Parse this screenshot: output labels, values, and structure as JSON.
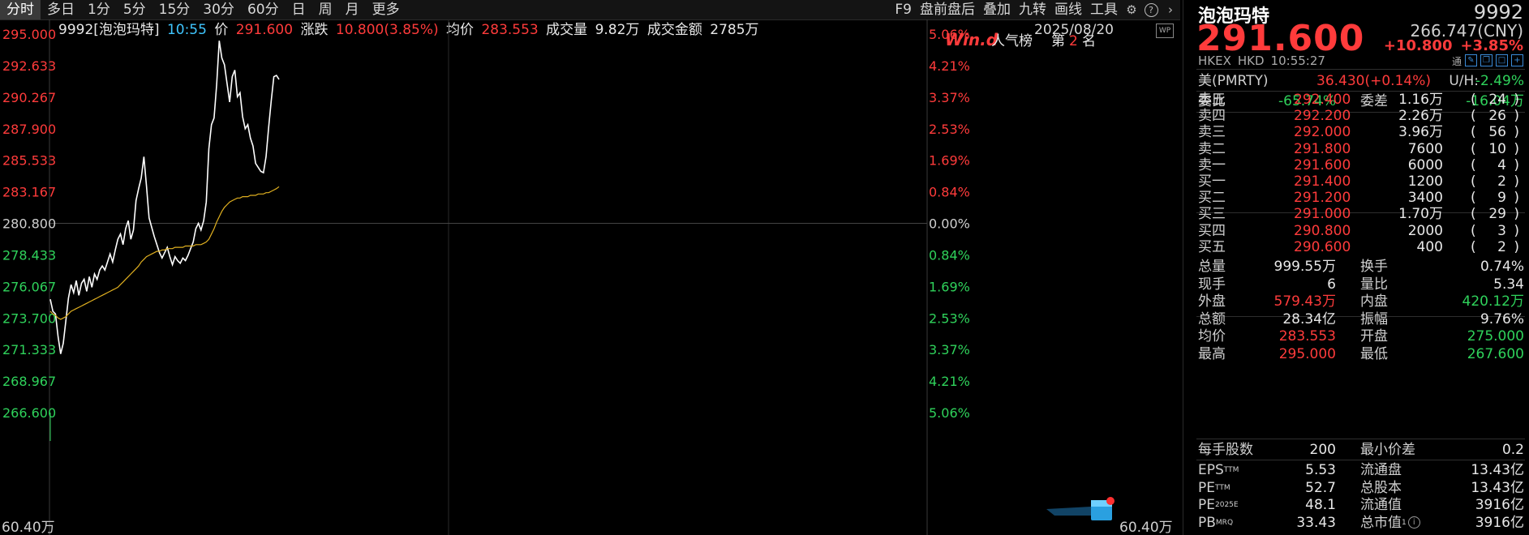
{
  "toolbar": {
    "tabs": [
      "分时",
      "多日",
      "1分",
      "5分",
      "15分",
      "30分",
      "60分",
      "日",
      "周",
      "月",
      "更多"
    ],
    "tools": [
      "F9",
      "盘前盘后",
      "叠加",
      "九转",
      "画线",
      "工具"
    ],
    "icons": [
      "gear-icon",
      "help-icon",
      "chevron-right-icon"
    ]
  },
  "info": {
    "code_name": "9992[泡泡玛特]",
    "time": "10:55",
    "price_label": "价",
    "price": "291.600",
    "change_label": "涨跌",
    "change": "10.800(3.85%)",
    "avg_label": "均价",
    "avg": "283.553",
    "vol_label": "成交量",
    "vol": "9.82万",
    "amount_label": "成交金额",
    "amount": "2785万",
    "date": "2025/08/20",
    "wp_badge": "WP"
  },
  "popularity": {
    "logo": "Win.d",
    "label": "人气榜",
    "rank_prefix": "第",
    "rank": "2",
    "rank_suffix": "名"
  },
  "chart_data": {
    "type": "line",
    "y_left_ticks": [
      "295.000",
      "292.633",
      "290.267",
      "287.900",
      "285.533",
      "283.167",
      "280.800",
      "278.433",
      "276.067",
      "273.700",
      "271.333",
      "268.967",
      "266.600"
    ],
    "y_right_ticks": [
      "5.06%",
      "4.21%",
      "3.37%",
      "2.53%",
      "1.69%",
      "0.84%",
      "0.00%",
      "0.84%",
      "1.69%",
      "2.53%",
      "3.37%",
      "4.21%",
      "5.06%"
    ],
    "ylim": [
      266.6,
      295.0
    ],
    "prev_close": 280.8,
    "volume_axis_left": "60.40万",
    "volume_axis_right": "60.40万",
    "x_minutes_total": 330,
    "series": [
      {
        "values": [
          275.1,
          274.2,
          274.0,
          272.3,
          271.0,
          271.8,
          273.5,
          275.2,
          276.2,
          275.6,
          276.5,
          275.4,
          276.3,
          276.6,
          275.7,
          276.8,
          276.0,
          277.0,
          276.6,
          277.3,
          277.6,
          277.3,
          277.9,
          278.5,
          277.9,
          278.8,
          279.6,
          280.0,
          279.2,
          280.4,
          281.0,
          279.6,
          280.3,
          282.5,
          283.4,
          284.2,
          285.8,
          283.6,
          281.2,
          280.5,
          279.8,
          279.2,
          278.6,
          278.2,
          278.6,
          279.0,
          278.3,
          277.7,
          278.3,
          278.0,
          277.8,
          278.2,
          278.0,
          278.4,
          278.9,
          279.4,
          280.4,
          280.8,
          280.3,
          281.0,
          282.4,
          286.4,
          288.2,
          288.7,
          291.2,
          294.5,
          293.2,
          292.7,
          291.3,
          289.9,
          291.8,
          292.3,
          290.3,
          290.6,
          288.8,
          287.9,
          288.2,
          287.2,
          286.6,
          285.3,
          285.0,
          284.7,
          284.6,
          285.8,
          288.0,
          290.0,
          291.8,
          291.9,
          291.6
        ]
      },
      {
        "values": [
          274.2,
          274.0,
          273.9,
          273.7,
          273.6,
          273.7,
          273.8,
          274.0,
          274.2,
          274.3,
          274.4,
          274.5,
          274.6,
          274.7,
          274.8,
          274.9,
          275.0,
          275.1,
          275.2,
          275.3,
          275.4,
          275.5,
          275.6,
          275.7,
          275.8,
          275.9,
          276.0,
          276.2,
          276.4,
          276.6,
          276.8,
          277.0,
          277.2,
          277.4,
          277.6,
          277.9,
          278.1,
          278.3,
          278.4,
          278.5,
          278.6,
          278.7,
          278.7,
          278.8,
          278.8,
          278.9,
          278.9,
          278.9,
          279.0,
          279.0,
          279.0,
          279.0,
          279.1,
          279.1,
          279.1,
          279.1,
          279.2,
          279.2,
          279.2,
          279.3,
          279.4,
          279.6,
          280.0,
          280.4,
          280.9,
          281.3,
          281.7,
          282.0,
          282.2,
          282.4,
          282.5,
          282.6,
          282.7,
          282.7,
          282.8,
          282.8,
          282.8,
          282.9,
          282.9,
          282.9,
          283.0,
          283.0,
          283.0,
          283.1,
          283.1,
          283.2,
          283.3,
          283.4,
          283.55
        ]
      }
    ],
    "colors": {
      "price": "#ffffff",
      "avg": "#e0b020",
      "up": "#ff3b3b",
      "down": "#2fd25b",
      "grid": "#2a2a2a"
    }
  },
  "quote": {
    "name": "泡泡玛特",
    "code": "9992",
    "price": "291.600",
    "cny": "266.747(CNY)",
    "change": "+10.800",
    "pct": "+3.85%",
    "market": "HKEX",
    "currency": "HKD",
    "time": "10:55:27",
    "tong": "通",
    "us_label": "美(PMRTY)",
    "us_value": "36.430(+0.14%)",
    "uh_label": "U/H:",
    "uh_value": "-2.49%",
    "weibi_label": "委比",
    "weibi": "-65.74%",
    "weicha_label": "委差",
    "weicha": "-16.04万"
  },
  "orderbook": {
    "asks": [
      {
        "label": "卖五",
        "price": "292.400",
        "vol": "1.16万",
        "count": "24"
      },
      {
        "label": "卖四",
        "price": "292.200",
        "vol": "2.26万",
        "count": "26"
      },
      {
        "label": "卖三",
        "price": "292.000",
        "vol": "3.96万",
        "count": "56"
      },
      {
        "label": "卖二",
        "price": "291.800",
        "vol": "7600",
        "count": "10"
      },
      {
        "label": "卖一",
        "price": "291.600",
        "vol": "6000",
        "count": "4"
      }
    ],
    "bids": [
      {
        "label": "买一",
        "price": "291.400",
        "vol": "1200",
        "count": "2"
      },
      {
        "label": "买二",
        "price": "291.200",
        "vol": "3400",
        "count": "9"
      },
      {
        "label": "买三",
        "price": "291.000",
        "vol": "1.70万",
        "count": "29"
      },
      {
        "label": "买四",
        "price": "290.800",
        "vol": "2000",
        "count": "3"
      },
      {
        "label": "买五",
        "price": "290.600",
        "vol": "400",
        "count": "2"
      }
    ]
  },
  "stats": [
    {
      "l1": "总量",
      "v1": "999.55万",
      "c1": "wh",
      "l2": "换手",
      "v2": "0.74%",
      "c2": "wh"
    },
    {
      "l1": "现手",
      "v1": "6",
      "c1": "wh",
      "l2": "量比",
      "v2": "5.34",
      "c2": "wh"
    },
    {
      "l1": "外盘",
      "v1": "579.43万",
      "c1": "up",
      "l2": "内盘",
      "v2": "420.12万",
      "c2": "dn"
    },
    {
      "l1": "总额",
      "v1": "28.34亿",
      "c1": "wh",
      "l2": "振幅",
      "v2": "9.76%",
      "c2": "wh"
    },
    {
      "l1": "均价",
      "v1": "283.553",
      "c1": "up",
      "l2": "开盘",
      "v2": "275.000",
      "c2": "dn"
    },
    {
      "l1": "最高",
      "v1": "295.000",
      "c1": "up",
      "l2": "最低",
      "v2": "267.600",
      "c2": "dn"
    }
  ],
  "stats2": [
    {
      "l1": "每手股数",
      "v1": "200",
      "l2": "最小价差",
      "v2": "0.2"
    }
  ],
  "valuation": [
    {
      "l1": "EPS",
      "s1": "TTM",
      "v1": "5.53",
      "l2": "流通盘",
      "v2": "13.43亿"
    },
    {
      "l1": "PE",
      "s1": "TTM",
      "v1": "52.7",
      "l2": "总股本",
      "v2": "13.43亿"
    },
    {
      "l1": "PE",
      "s1": "2025E",
      "v1": "48.1",
      "l2": "流通值",
      "v2": "3916亿"
    },
    {
      "l1": "PB",
      "s1": "MRQ",
      "v1": "33.43",
      "l2": "总市值",
      "s2": "1",
      "v2": "3916亿"
    }
  ]
}
